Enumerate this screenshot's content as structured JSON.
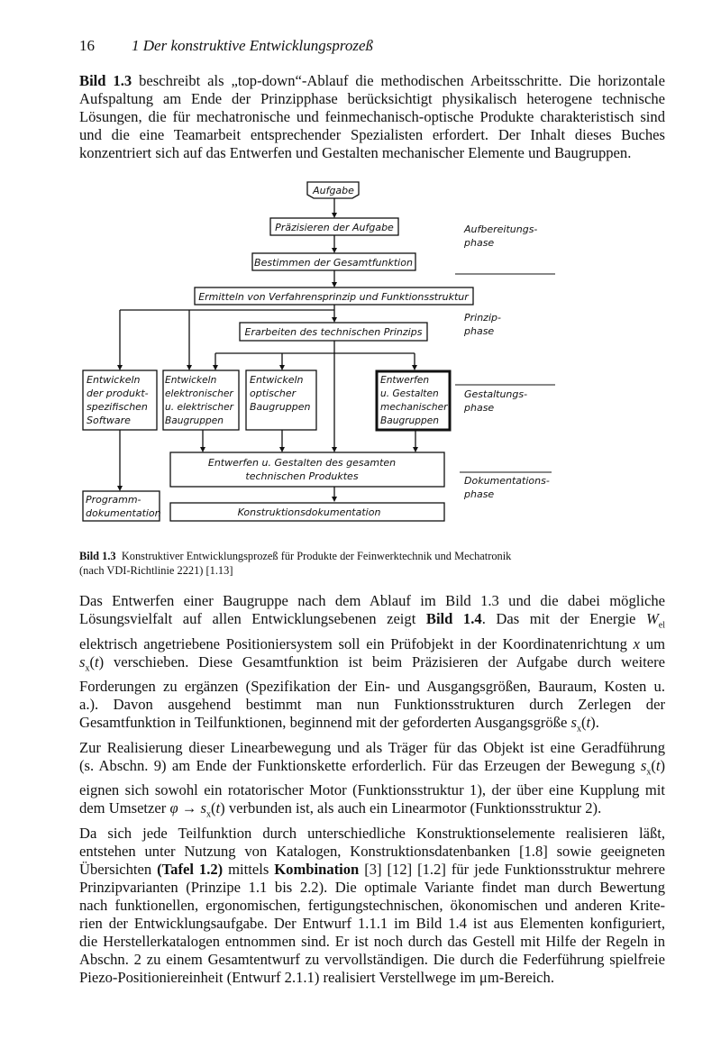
{
  "header": {
    "page_number": "16",
    "chapter_title": "1  Der konstruktive Entwicklungsprozeß"
  },
  "paragraph1": {
    "lines": [
      [
        "Bild 1.3",
        " beschreibt als „top-down“-Ablauf die methodischen Arbeitsschritte. Die horizontale"
      ],
      [
        "",
        "Aufspaltung am Ende der Prinzipphase berücksichtigt physikalisch heterogene technische"
      ],
      [
        "",
        "Lösungen, die für mechatronische und feinmechanisch-optische Produkte charakteristisch sind"
      ],
      [
        "",
        "und die eine Teamarbeit entsprechender Spezialisten erfordert. Der Inhalt dieses Buches"
      ],
      [
        "",
        "konzentriert sich auf das Entwerfen und Gestalten mechanischer Elemente und Baugruppen."
      ]
    ]
  },
  "diagram": {
    "nodes": {
      "aufgabe": "Aufgabe",
      "praezisieren": "Präzisieren der Aufgabe",
      "bestimmen": "Bestimmen der Gesamtfunktion",
      "ermitteln": "Ermitteln von Verfahrensprinzip und Funktionsstruktur",
      "erarbeiten": "Erarbeiten des technischen Prinzips",
      "software": [
        "Entwickeln",
        "der produkt-",
        "spezifischen",
        "Software"
      ],
      "elektronisch": [
        "Entwickeln",
        "elektronischer",
        "u. elektrischer",
        "Baugruppen"
      ],
      "optisch": [
        "Entwickeln",
        "optischer",
        "Baugruppen"
      ],
      "mechanisch": [
        "Entwerfen",
        "u. Gestalten",
        "mechanischer",
        "Baugruppen"
      ],
      "gesamt": [
        "Entwerfen u. Gestalten des gesamten",
        "technischen Produktes"
      ],
      "programmdoku": [
        "Programm-",
        "dokumentation"
      ],
      "konstruktionsdoku": "Konstruktionsdokumentation"
    },
    "phases": [
      [
        "Aufbereitungs-",
        "phase"
      ],
      [
        "Prinzip-",
        "phase"
      ],
      [
        "Gestaltungs-",
        "phase"
      ],
      [
        "Dokumentations-",
        "phase"
      ]
    ]
  },
  "caption": {
    "label": "Bild 1.3",
    "line1": "Konstruktiver Entwicklungsprozeß für Produkte der Feinwerktechnik und Mechatronik",
    "line2": "(nach  VDI-Richtlinie 2221) [1.13]"
  },
  "paragraph2": {
    "lines": [
      "Das Entwerfen einer Baugruppe nach dem Ablauf im Bild 1.3 und die dabei mögliche",
      "Lösungsvielfalt auf allen Entwicklungsebenen zeigt §Bild 1.4§. Das mit der Energie W_el",
      "elektrisch angetriebene Positioniersystem soll ein Prüfobjekt in der Koordinatenrichtung x um",
      "s_x(t) verschieben. Diese Gesamtfunktion ist beim Präzisieren der Aufgabe durch weitere",
      "Forderungen zu ergänzen (Spezifikation der Ein- und Ausgangsgrößen, Bauraum, Kosten u.",
      "a.). Davon ausgehend bestimmt man nun Funktionsstrukturen durch Zerlegen der",
      "Gesamtfunktion in Teilfunktionen, beginnend mit der geforderten Ausgangsgröße s_x(t).",
      "Zur Realisierung dieser Linearbewegung und als Träger für das Objekt ist eine Geradführung",
      "(s. Abschn. 9) am Ende der Funktionskette erforderlich. Für das Erzeugen der Bewegung s_x(t)",
      "eignen sich sowohl ein rotatorischer Motor (Funktionsstruktur 1), der über eine Kupplung mit",
      "dem Umsetzer φ → s_x(t) verbunden ist, als auch ein Linearmotor (Funktionsstruktur 2).",
      "Da sich jede Teilfunktion durch unterschiedliche Konstruktionselemente realisieren läßt,",
      "entstehen unter Nutzung von Katalogen, Konstruktionsdatenbanken [1.8] sowie geeigneten",
      "Übersichten §(Tafel 1.2)§ mittels §Kombination§ [3] [12] [1.2] für jede Funktionsstruktur mehrere",
      "Prinzipvarianten (Prinzipe 1.1 bis 2.2). Die optimale Variante findet man durch Bewertung",
      "nach funktionellen, ergonomischen, fertigungstechnischen, ökonomischen und anderen Krite-",
      "rien der Entwicklungsaufgabe. Der Entwurf 1.1.1 im Bild 1.4 ist aus Elementen konfiguriert,",
      "die Herstellerkatalogen entnommen sind. Er ist noch durch das Gestell mit Hilfe der Regeln in",
      "Abschn. 2 zu einem Gesamtentwurf zu vervollständigen. Die durch die Federführung spielfreie",
      "Piezo-Positioniereinheit (Entwurf 2.1.1) realisiert Verstellwege im μm-Bereich."
    ],
    "justified_last_exceptions": [
      6,
      10,
      19
    ]
  }
}
